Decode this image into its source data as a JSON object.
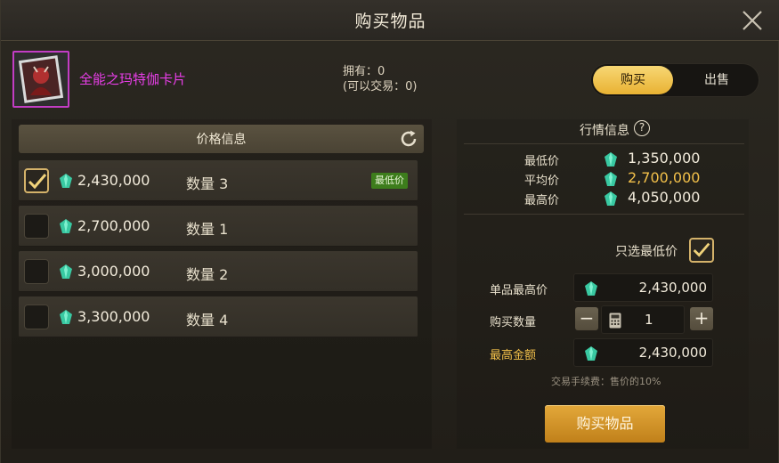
{
  "window": {
    "title": "购买物品"
  },
  "item": {
    "name": "全能之玛特伽卡片",
    "owned_line": "拥有：0",
    "tradable_line": "(可以交易：0)"
  },
  "mode_toggle": {
    "buy": "购买",
    "sell": "出售",
    "active": "buy"
  },
  "price_list": {
    "header": "价格信息",
    "rows": [
      {
        "price": "2,430,000",
        "qty": "数量 3",
        "checked": true,
        "badge": "最低价"
      },
      {
        "price": "2,700,000",
        "qty": "数量 1",
        "checked": false
      },
      {
        "price": "3,000,000",
        "qty": "数量 2",
        "checked": false
      },
      {
        "price": "3,300,000",
        "qty": "数量 4",
        "checked": false
      }
    ]
  },
  "market": {
    "title": "行情信息",
    "help_symbol": "?",
    "lowest_label": "最低价",
    "lowest": "1,350,000",
    "average_label": "平均价",
    "average": "2,700,000",
    "highest_label": "最高价",
    "highest": "4,050,000"
  },
  "form": {
    "only_lowest_label": "只选最低价",
    "only_lowest_checked": true,
    "unit_max_label": "单品最高价",
    "unit_max": "2,430,000",
    "qty_label": "购买数量",
    "qty": "1",
    "minus": "−",
    "plus": "+",
    "total_label": "最高金额",
    "total": "2,430,000",
    "fee": "交易手续费：售价的10%"
  },
  "buy_button": "购买物品",
  "colors": {
    "accent": "#f2c04a",
    "item_rarity": "#e83ee8",
    "badge": "#3d7d1c"
  }
}
